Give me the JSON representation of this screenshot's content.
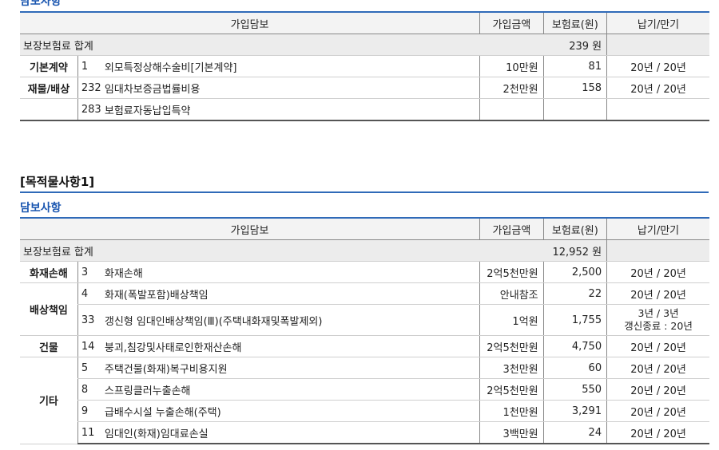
{
  "section1": {
    "title_partial": "담보사항",
    "headers": [
      "가입담보",
      "가입금액",
      "보험료(원)",
      "납기/만기"
    ],
    "total_label": "보장보험료 합계",
    "total_value": "239 원",
    "rows": [
      {
        "category": "기본계약",
        "code": "1",
        "name": "외모특정상해수술비[기본계약]",
        "amount": "10만원",
        "premium": "81",
        "term": "20년 / 20년"
      },
      {
        "category": "재물/배상",
        "code": "232",
        "name": "임대차보증금법률비용",
        "amount": "2천만원",
        "premium": "158",
        "term": "20년 / 20년"
      },
      {
        "category": "",
        "code": "283",
        "name": "보험료자동납입특약",
        "amount": "",
        "premium": "",
        "term": ""
      }
    ]
  },
  "object_title": "[목적물사항1]",
  "section2": {
    "title": "담보사항",
    "headers": [
      "가입담보",
      "가입금액",
      "보험료(원)",
      "납기/만기"
    ],
    "total_label": "보장보험료 합계",
    "total_value": "12,952 원",
    "groups": [
      {
        "category": "화재손해",
        "rows": [
          {
            "code": "3",
            "name": "화재손해",
            "amount": "2억5천만원",
            "premium": "2,500",
            "term": "20년 / 20년"
          }
        ]
      },
      {
        "category": "배상책임",
        "rows": [
          {
            "code": "4",
            "name": "화재(폭발포함)배상책임",
            "amount": "안내참조",
            "premium": "22",
            "term": "20년 / 20년"
          },
          {
            "code": "33",
            "name": "갱신형 임대인배상책임(Ⅲ)(주택내화재및폭발제외)",
            "amount": "1억원",
            "premium": "1,755",
            "term": "3년 / 3년",
            "term2": "갱신종료 : 20년"
          }
        ]
      },
      {
        "category": "건물",
        "rows": [
          {
            "code": "14",
            "name": "붕괴,침강및사태로인한재산손해",
            "amount": "2억5천만원",
            "premium": "4,750",
            "term": "20년 / 20년"
          }
        ]
      },
      {
        "category": "기타",
        "rows": [
          {
            "code": "5",
            "name": "주택건물(화재)복구비용지원",
            "amount": "3천만원",
            "premium": "60",
            "term": "20년 / 20년"
          },
          {
            "code": "8",
            "name": "스프링클러누출손해",
            "amount": "2억5천만원",
            "premium": "550",
            "term": "20년 / 20년"
          },
          {
            "code": "9",
            "name": "급배수시설 누출손해(주택)",
            "amount": "1천만원",
            "premium": "3,291",
            "term": "20년 / 20년"
          },
          {
            "code": "11",
            "name": "임대인(화재)임대료손실",
            "amount": "3백만원",
            "premium": "24",
            "term": "20년 / 20년"
          }
        ]
      }
    ]
  }
}
